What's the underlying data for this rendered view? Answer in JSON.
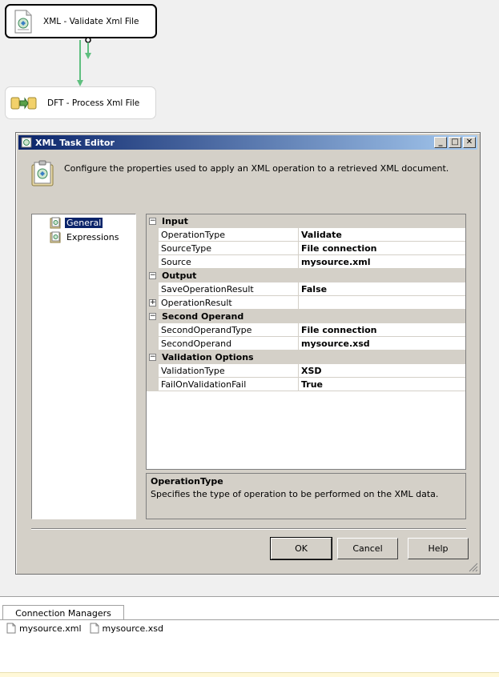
{
  "canvas": {
    "task_validate": {
      "label": "XML - Validate Xml File",
      "icon": "xml-document-icon"
    },
    "task_dft": {
      "label": "DFT - Process Xml File",
      "icon": "data-flow-icon"
    },
    "connector_color": "#5fbf7f"
  },
  "dialog": {
    "title": "XML Task Editor",
    "header_text": "Configure the properties used to apply an XML operation to a retrieved XML document.",
    "nav": [
      {
        "label": "General",
        "selected": true
      },
      {
        "label": "Expressions",
        "selected": false
      }
    ],
    "grid": {
      "categories": [
        {
          "name": "Input",
          "rows": [
            {
              "name": "OperationType",
              "value": "Validate"
            },
            {
              "name": "SourceType",
              "value": "File connection"
            },
            {
              "name": "Source",
              "value": "mysource.xml"
            }
          ]
        },
        {
          "name": "Output",
          "rows": [
            {
              "name": "SaveOperationResult",
              "value": "False"
            },
            {
              "name": "OperationResult",
              "value": ""
            }
          ]
        },
        {
          "name": "Second Operand",
          "rows": [
            {
              "name": "SecondOperandType",
              "value": "File connection"
            },
            {
              "name": "SecondOperand",
              "value": "mysource.xsd"
            }
          ]
        },
        {
          "name": "Validation Options",
          "rows": [
            {
              "name": "ValidationType",
              "value": "XSD"
            },
            {
              "name": "FailOnValidationFail",
              "value": "True"
            }
          ]
        }
      ]
    },
    "description": {
      "title": "OperationType",
      "text": "Specifies the type of operation to be performed on the XML data."
    },
    "buttons": {
      "ok": "OK",
      "cancel": "Cancel",
      "help": "Help"
    },
    "title_buttons": {
      "minimize": "_",
      "maximize": "□",
      "close": "✕"
    }
  },
  "connection_managers": {
    "tab_label": "Connection Managers",
    "items": [
      {
        "label": "mysource.xml"
      },
      {
        "label": "mysource.xsd"
      }
    ]
  },
  "colors": {
    "title_gradient_start": "#0a246a",
    "title_gradient_end": "#a6caf0",
    "dialog_face": "#d4d0c8",
    "selection": "#0a246a"
  }
}
